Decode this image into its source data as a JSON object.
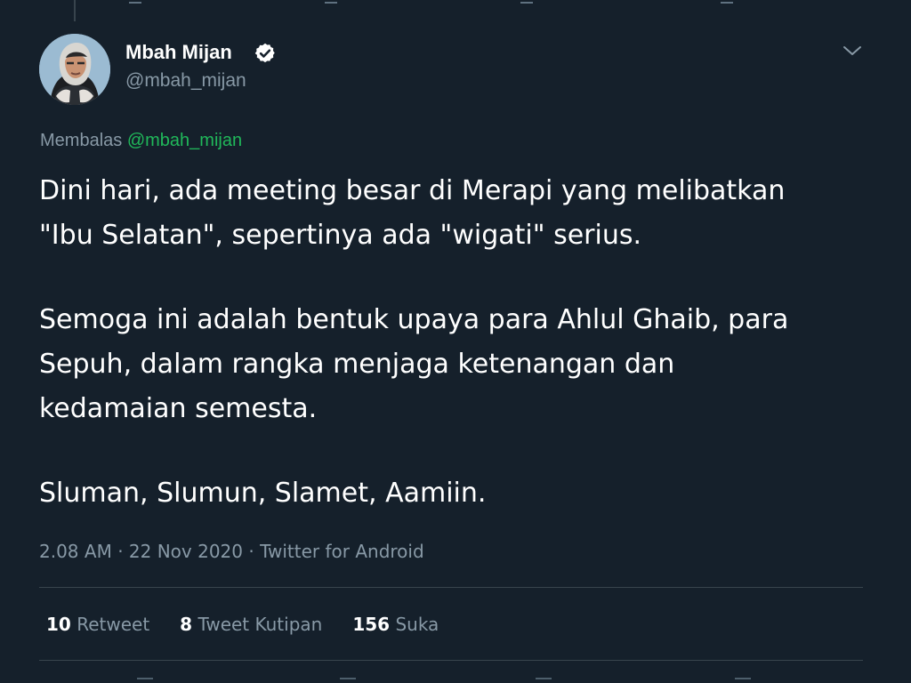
{
  "author": {
    "name": "Mbah Mijan",
    "handle": "@mbah_mijan",
    "verified": true,
    "avatar_icon": "user-avatar"
  },
  "reply": {
    "prefix": "Membalas",
    "to": "@mbah_mijan"
  },
  "tweet": {
    "paragraphs": [
      "Dini hari, ada meeting besar di Merapi yang melibatkan\n\"Ibu Selatan\", sepertinya ada \"wigati\" serius.",
      "Semoga ini adalah bentuk upaya para Ahlul Ghaib, para\nSepuh, dalam rangka menjaga ketenangan dan\nkedamaian semesta.",
      "Sluman, Slumun, Slamet, Aamiin."
    ]
  },
  "meta": {
    "time": "2.08 AM",
    "date": "22 Nov 2020",
    "separator": "·",
    "source": "Twitter for Android"
  },
  "stats": {
    "retweets": {
      "count": "10",
      "label": "Retweet"
    },
    "quotes": {
      "count": "8",
      "label": "Tweet Kutipan"
    },
    "likes": {
      "count": "156",
      "label": "Suka"
    }
  },
  "icons": {
    "verified": "verified-badge-icon",
    "more": "chevron-down-icon"
  },
  "colors": {
    "background": "#15202b",
    "text_primary": "#ffffff",
    "text_secondary": "#8899a6",
    "link": "#20b85a",
    "divider": "#38444d"
  }
}
